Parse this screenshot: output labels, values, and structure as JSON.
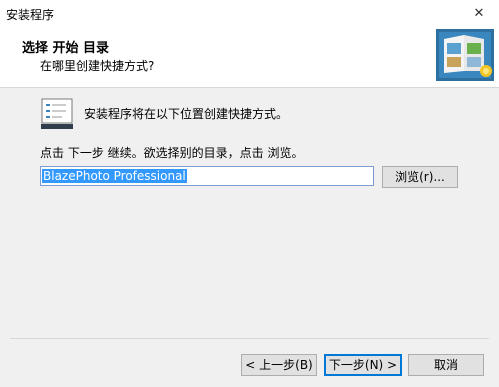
{
  "window": {
    "title": "安装程序",
    "close_glyph": "✕"
  },
  "header": {
    "title": "选择 开始 目录",
    "subtitle": "在哪里创建快捷方式?",
    "logo_icon": "photo-album-logo"
  },
  "content": {
    "intro": "安装程序将在以下位置创建快捷方式。",
    "hint": "点击 下一步 继续。欲选择别的目录，点击 浏览。",
    "folder_value": "BlazePhoto Professional",
    "browse_label": "浏览(r)..."
  },
  "footer": {
    "brand_text": "",
    "back_label": "< 上一步(B)",
    "next_label": "下一步(N) >",
    "cancel_label": "取消"
  },
  "colors": {
    "accent": "#0078d7",
    "selection": "#3399ff"
  }
}
